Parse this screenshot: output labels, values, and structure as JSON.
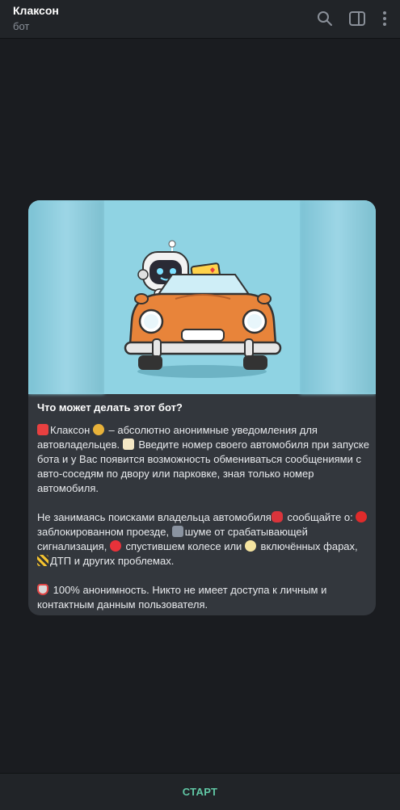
{
  "header": {
    "title": "Клаксон",
    "subtitle": "бот"
  },
  "card": {
    "heading": "Что может делать этот бот?",
    "paragraph_1": "Клаксон — абсолютно анонимные уведомления для автовладельцев. Введите номер своего автомобиля при запуске бота и у Вас появится возможность обмениваться сообщениями с авто-соседям по двору или парковке, зная только номер автомобиля.",
    "p1_a": "Клаксон ",
    "p1_b": " – абсолютно анонимные уведомления для автовладельцев. ",
    "p1_c": " Введите номер своего автомобиля при запуске бота и у Вас появится возможность обмениваться сообщениями с авто-соседям по двору или парковке, зная только номер автомобиля.",
    "p2_a": "Не занимаясь поисками владельца автомобиля",
    "p2_b": " сообщайте о:",
    "p2_c": "заблокированном проезде, ",
    "p2_d": "шуме от срабатывающей сигнализация, ",
    "p2_e": " спустившем колесе или ",
    "p2_f": " включённых фарах, ",
    "p2_g": "ДТП и других проблемах.",
    "p3": " 100% анонимность. Никто не имеет доступа к личным и контактным данным пользователя."
  },
  "footer": {
    "start_label": "СТАРТ"
  },
  "icons": {
    "search": "search-icon",
    "sidebar": "sidebar-toggle-icon",
    "more": "more-vertical-icon"
  },
  "colors": {
    "background": "#1a1c20",
    "header": "#212428",
    "card": "#33373d",
    "accent": "#61c7a5",
    "car": "#e8843a"
  }
}
